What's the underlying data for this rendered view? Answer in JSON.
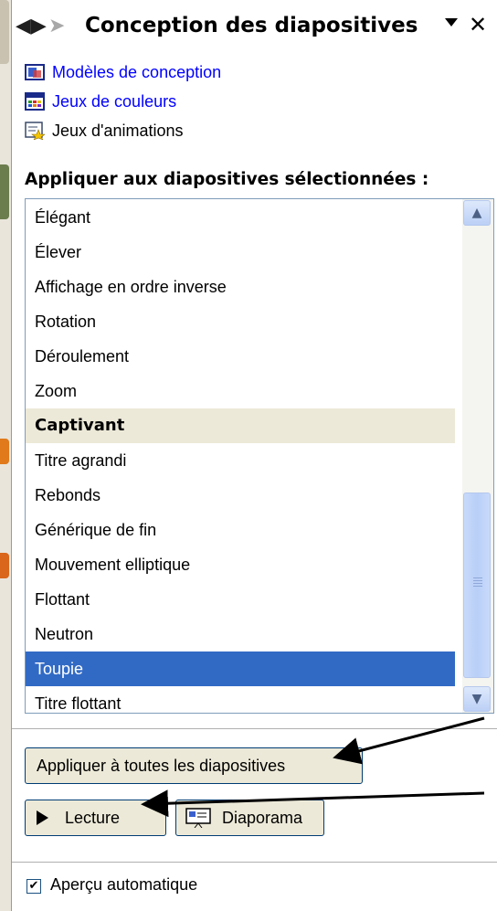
{
  "panel": {
    "title": "Conception des diapositives",
    "back_icon": "back-arrow-icon",
    "forward_icon": "forward-arrow-icon",
    "menu_icon": "dropdown-arrow-icon",
    "close_icon": "close-icon"
  },
  "links": [
    {
      "label": "Modèles de conception",
      "icon": "design-templates-icon"
    },
    {
      "label": "Jeux de couleurs",
      "icon": "color-schemes-icon"
    },
    {
      "label": "Jeux d'animations",
      "icon": "animation-schemes-icon"
    }
  ],
  "apply_heading": "Appliquer aux diapositives sélectionnées :",
  "animation_list": [
    {
      "label": "Élégant"
    },
    {
      "label": "Élever"
    },
    {
      "label": "Affichage en ordre inverse"
    },
    {
      "label": "Rotation"
    },
    {
      "label": "Déroulement"
    },
    {
      "label": "Zoom"
    },
    {
      "label": "Captivant",
      "category": true
    },
    {
      "label": "Titre agrandi"
    },
    {
      "label": "Rebonds"
    },
    {
      "label": "Générique de fin"
    },
    {
      "label": "Mouvement elliptique"
    },
    {
      "label": "Flottant"
    },
    {
      "label": "Neutron"
    },
    {
      "label": "Toupie",
      "selected": true
    },
    {
      "label": "Titre flottant"
    }
  ],
  "buttons": {
    "apply_all": "Appliquer à toutes les diapositives",
    "play": "Lecture",
    "slideshow": "Diaporama"
  },
  "autopreview": {
    "label": "Aperçu automatique",
    "checked": true
  },
  "colors": {
    "link": "#0000ff",
    "selection": "#316ac5",
    "category_bg": "#ece9d8",
    "button_bg": "#ece9d8"
  }
}
